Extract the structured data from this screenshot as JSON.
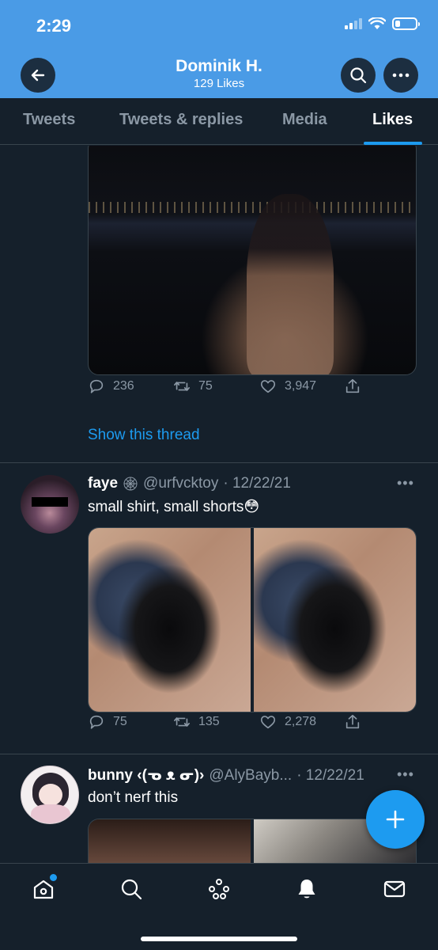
{
  "status_bar": {
    "time": "2:29",
    "battery_level": 0.25
  },
  "header": {
    "title": "Dominik H.",
    "subtitle": "129 Likes"
  },
  "tabs": [
    {
      "label": "Tweets"
    },
    {
      "label": "Tweets & replies"
    },
    {
      "label": "Media"
    },
    {
      "label": "Likes",
      "active": true
    }
  ],
  "tweet1": {
    "replies": "236",
    "retweets": "75",
    "likes": "3,947",
    "thread_link": "Show this thread"
  },
  "tweet2": {
    "name": "faye",
    "handle": "@urfvcktoy",
    "date": "· 12/22/21",
    "text": "small shirt, small shorts😳",
    "replies": "75",
    "retweets": "135",
    "likes": "2,278"
  },
  "tweet3": {
    "name": "bunny ‹(ᓀ ᴥ ᓂ)›",
    "handle": "@AlyBayb...",
    "date": "· 12/22/21",
    "text": "don’t nerf this"
  },
  "colors": {
    "accent": "#1d9bf0",
    "header_bg": "#4a9be6",
    "background": "#15202b",
    "muted": "#8b98a5"
  },
  "icons": [
    "back-arrow-icon",
    "search-icon",
    "more-icon",
    "reply-icon",
    "retweet-icon",
    "heart-icon",
    "share-icon",
    "home-icon",
    "explore-icon",
    "spaces-icon",
    "notifications-icon",
    "messages-icon",
    "compose-icon"
  ]
}
